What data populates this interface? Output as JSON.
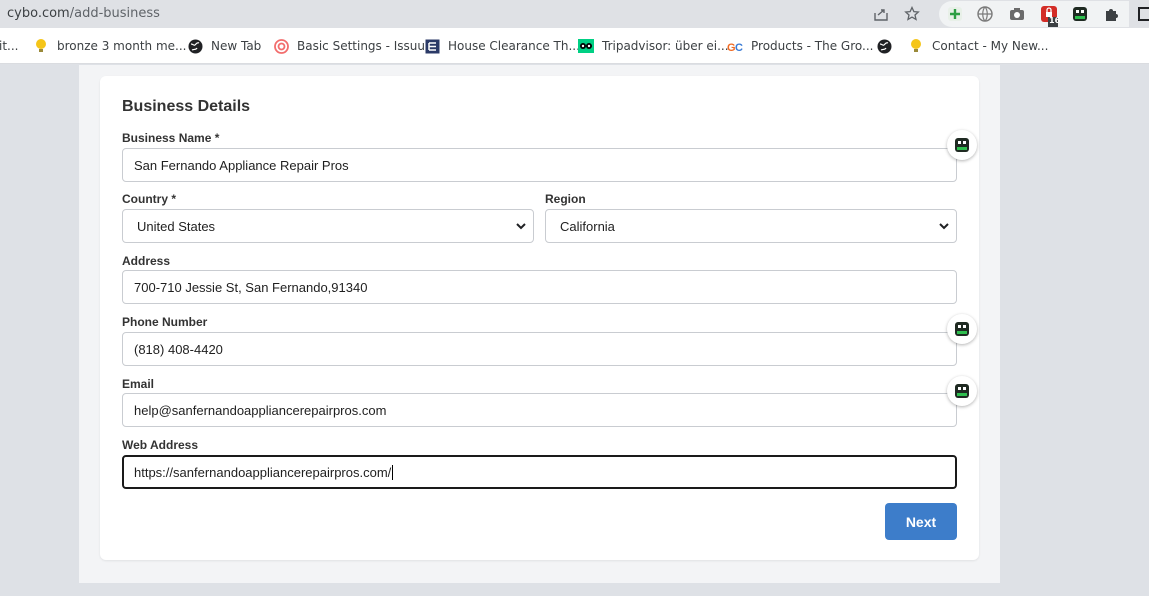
{
  "browser": {
    "url_host": "cybo.com",
    "url_path": "/add-business",
    "extension_badge": "16"
  },
  "bookmarks": [
    {
      "label": "it...",
      "icon": "bookmark-icon"
    },
    {
      "label": "bronze 3 month me...",
      "icon": "lightbulb-icon"
    },
    {
      "label": "New Tab",
      "icon": "globe-icon"
    },
    {
      "label": "Basic Settings - Issuu",
      "icon": "target-icon"
    },
    {
      "label": "House Clearance Th...",
      "icon": "site-icon"
    },
    {
      "label": "Tripadvisor: über ei...",
      "icon": "tripadvisor-icon"
    },
    {
      "label": "Products - The Gro...",
      "icon": "gc-icon"
    },
    {
      "label": "",
      "icon": "globe-icon"
    },
    {
      "label": "Contact - My New...",
      "icon": "lightbulb-icon"
    }
  ],
  "form": {
    "title": "Business Details",
    "business_name_label": "Business Name *",
    "business_name_value": "San Fernando Appliance Repair Pros",
    "country_label": "Country *",
    "country_value": "United States",
    "region_label": "Region",
    "region_value": "California",
    "address_label": "Address",
    "address_value": "700-710 Jessie St, San Fernando,91340",
    "phone_label": "Phone Number",
    "phone_value": "(818) 408-4420",
    "email_label": "Email",
    "email_value": "help@sanfernandoappliancerepairpros.com",
    "web_label": "Web Address",
    "web_value": "https://sanfernandoappliancerepairpros.com/",
    "next_label": "Next"
  },
  "colors": {
    "accent": "#3d7dca",
    "page_bg": "#dee1e6",
    "card_bg": "#ffffff"
  }
}
